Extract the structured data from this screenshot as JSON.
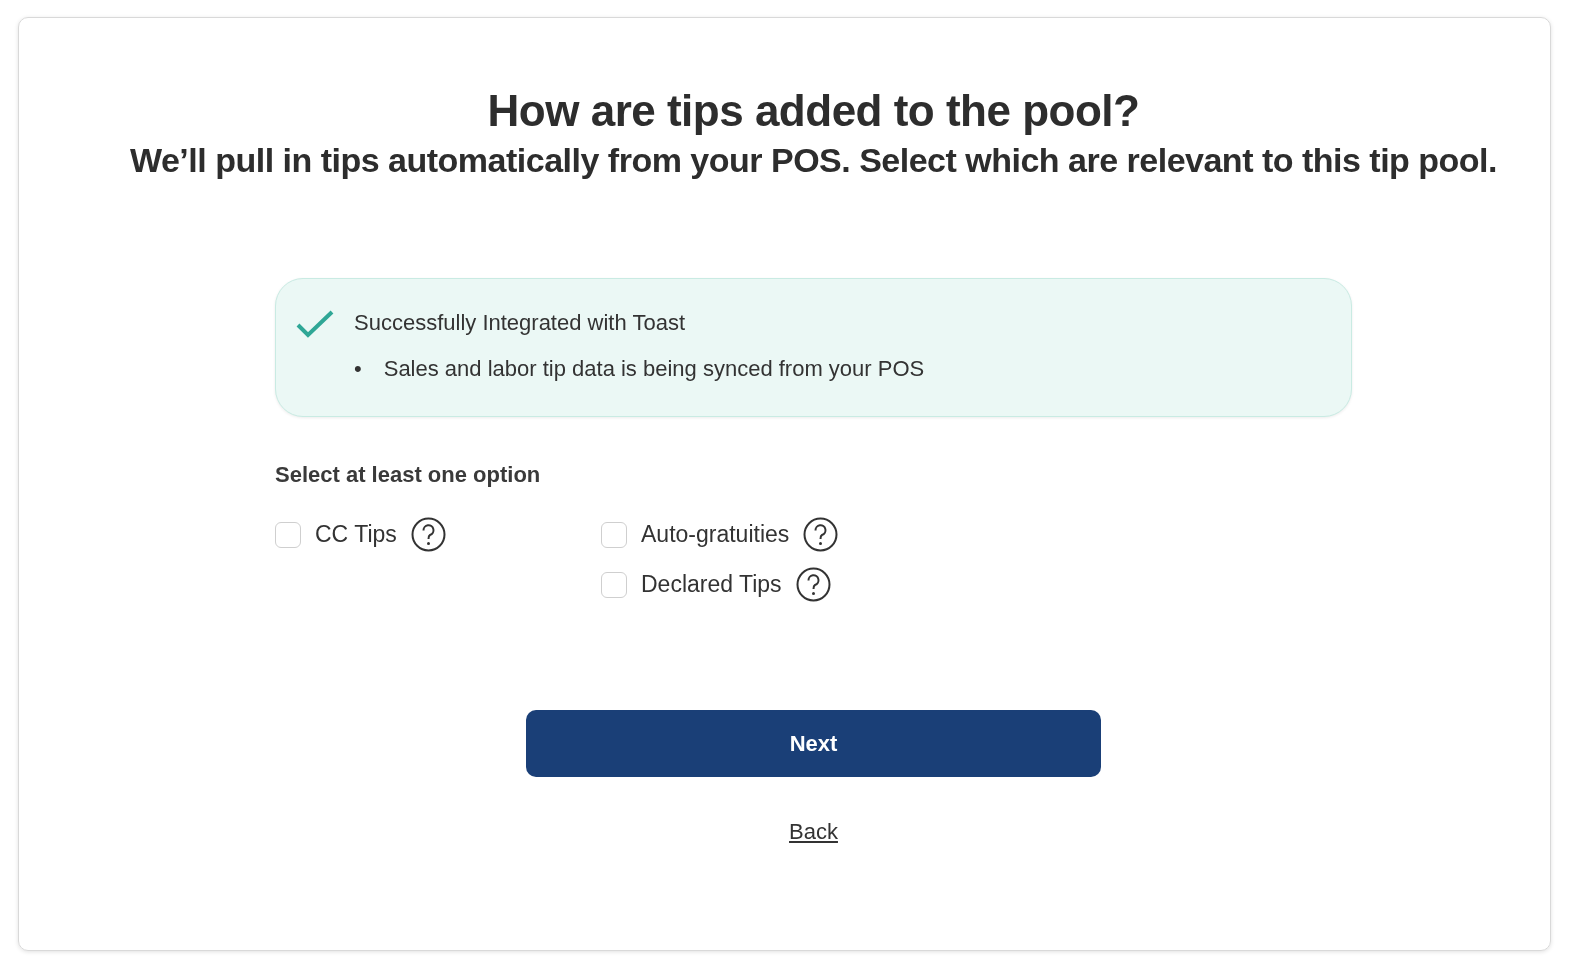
{
  "title": "How are tips added to the pool?",
  "subtitle": "We’ll pull in tips automatically from your POS. Select which are relevant to this tip pool.",
  "banner": {
    "title": "Successfully Integrated with Toast",
    "items": [
      {
        "marker": "•",
        "text": "Sales and labor tip data is being synced from your POS"
      }
    ]
  },
  "options": {
    "label": "Select at least one option",
    "columns": [
      [
        {
          "label": "CC Tips",
          "checked": false
        }
      ],
      [
        {
          "label": "Auto-gratuities",
          "checked": false
        },
        {
          "label": "Declared Tips",
          "checked": false
        }
      ]
    ]
  },
  "next_button": "Next",
  "back_link": "Back"
}
